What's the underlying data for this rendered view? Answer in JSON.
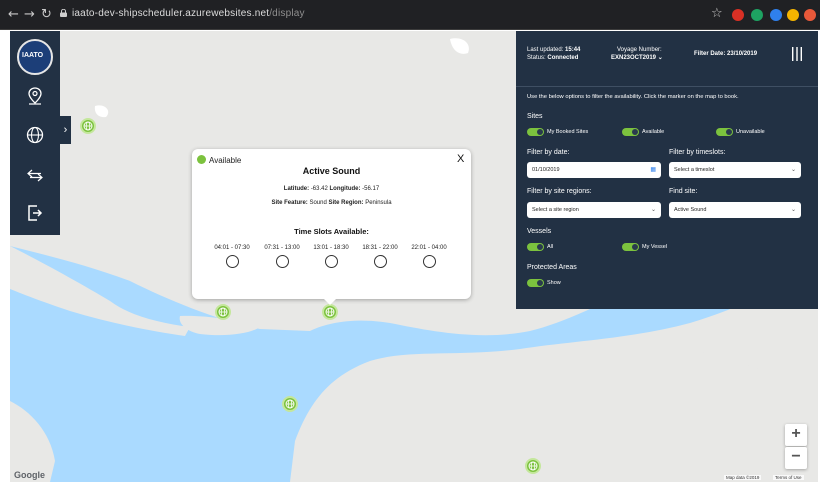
{
  "browser": {
    "url_host": "iaato-dev-shipscheduler.azurewebsites.net",
    "url_path": "/display",
    "back_icon": "arrow-left",
    "forward_icon": "arrow-right",
    "reload_icon": "reload",
    "bookmark_icon": "star"
  },
  "left_nav": {
    "logo_text": "IAATO",
    "items": [
      "location-pin-icon",
      "globe-icon",
      "swap-arrows-icon",
      "logout-icon"
    ],
    "collapse_glyph": "›"
  },
  "popup": {
    "status": "Available",
    "close": "X",
    "title": "Active Sound",
    "latitude_label": "Latitude:",
    "latitude": "-63.42",
    "longitude_label": "Longitude:",
    "longitude": "-56.17",
    "feature_label": "Site Feature:",
    "feature": "Sound",
    "region_label": "Site Region:",
    "region": "Peninsula",
    "slots_heading": "Time Slots Available:",
    "slots": [
      "04:01 - 07:30",
      "07:31 - 13:00",
      "13:01 - 18:30",
      "18:31 - 22:00",
      "22:01 - 04:00"
    ]
  },
  "panel": {
    "last_updated_label": "Last updated:",
    "last_updated": "15:44",
    "status_label": "Status:",
    "status": "Connected",
    "voyage_label": "Voyage Number:",
    "voyage": "EXN23OCT2019",
    "filter_date_label": "Filter Date:",
    "filter_date": "23/10/2019",
    "instructions": "Use the below options to filter the availability. Click the marker on the map to book.",
    "sites_heading": "Sites",
    "site_toggles": [
      "My Booked Sites",
      "Available",
      "Unavailable"
    ],
    "filter_by_date_label": "Filter by date:",
    "date_value": "01/10/2019",
    "filter_by_timeslots_label": "Filter by timeslots:",
    "timeslot_placeholder": "Select a timeslot",
    "filter_by_regions_label": "Filter by site regions:",
    "region_placeholder": "Select a site region",
    "find_site_label": "Find site:",
    "find_site_value": "Active Sound",
    "vessels_heading": "Vessels",
    "vessel_toggles": [
      "All",
      "My Vessel"
    ],
    "protected_heading": "Protected Areas",
    "protected_toggle": "Show"
  },
  "map": {
    "zoom_in": "+",
    "zoom_out": "−",
    "google": "Google",
    "map_data": "Map data ©2019",
    "terms": "Terms of Use"
  },
  "colors": {
    "panel_bg": "#223144",
    "accent_green": "#7cc23e",
    "water": "#aadaff",
    "land": "#e8e8e6"
  }
}
